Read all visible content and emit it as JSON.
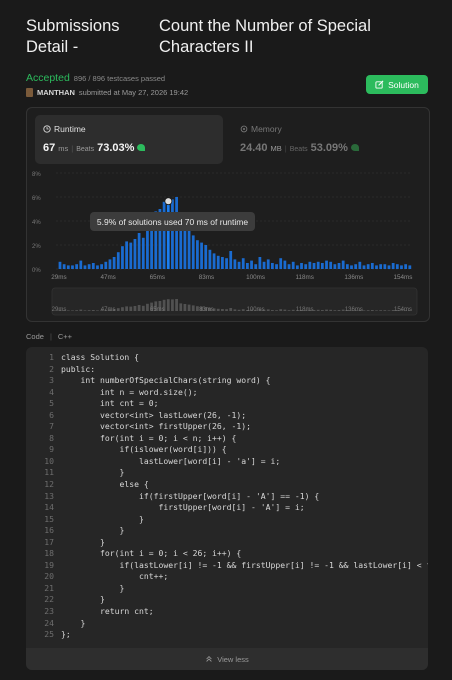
{
  "header": {
    "title_left": "Submissions Detail -",
    "title_right": "Count the Number of Special Characters II"
  },
  "status": {
    "result": "Accepted",
    "testcases": "896 / 896 testcases passed"
  },
  "submitter": {
    "name": "MANTHAN",
    "submitted": "submitted at May 27, 2026 19:42"
  },
  "solution_button": {
    "label": "Solution"
  },
  "runtime": {
    "label": "Runtime",
    "value": "67",
    "unit": "ms",
    "beats_label": "Beats",
    "beats_value": "73.03%"
  },
  "memory": {
    "label": "Memory",
    "value": "24.40",
    "unit": "MB",
    "beats_label": "Beats",
    "beats_value": "53.09%"
  },
  "tooltip": {
    "text": "5.9% of solutions used 70 ms of runtime"
  },
  "chart_data": {
    "type": "bar",
    "ylabel_ticks": [
      "8%",
      "6%",
      "4%",
      "2%",
      "0%"
    ],
    "ylim": [
      0,
      8
    ],
    "x_ticks": [
      "29ms",
      "47ms",
      "65ms",
      "83ms",
      "100ms",
      "118ms",
      "136ms",
      "154ms"
    ],
    "values": [
      0.6,
      0.4,
      0.3,
      0.3,
      0.4,
      0.7,
      0.3,
      0.4,
      0.5,
      0.3,
      0.4,
      0.6,
      0.8,
      1.0,
      1.4,
      1.9,
      2.3,
      2.2,
      2.5,
      3.0,
      2.6,
      3.6,
      4.2,
      4.8,
      5.0,
      5.6,
      5.9,
      5.8,
      6.0,
      3.8,
      3.5,
      3.2,
      2.8,
      2.4,
      2.2,
      2.0,
      1.6,
      1.3,
      1.1,
      1.0,
      0.9,
      1.5,
      0.8,
      0.6,
      0.9,
      0.5,
      0.7,
      0.4,
      1.0,
      0.6,
      0.8,
      0.5,
      0.4,
      0.9,
      0.7,
      0.4,
      0.6,
      0.3,
      0.5,
      0.4,
      0.6,
      0.5,
      0.6,
      0.5,
      0.7,
      0.6,
      0.4,
      0.5,
      0.7,
      0.4,
      0.3,
      0.4,
      0.6,
      0.3,
      0.4,
      0.5,
      0.3,
      0.4,
      0.4,
      0.3,
      0.5,
      0.4,
      0.3,
      0.4,
      0.3
    ],
    "highlighted_index": 26,
    "highlight_color": "#1a7ef2",
    "bar_color": "#1a6bd0",
    "dim_bar_color": "#4a4a4a"
  },
  "code_tab": {
    "label": "Code",
    "lang": "C++"
  },
  "code_lines": [
    "class Solution {",
    "public:",
    "    int numberOfSpecialChars(string word) {",
    "        int n = word.size();",
    "        int cnt = 0;",
    "        vector<int> lastLower(26, -1);",
    "        vector<int> firstUpper(26, -1);",
    "        for(int i = 0; i < n; i++) {",
    "            if(islower(word[i])) {",
    "                lastLower[word[i] - 'a'] = i;",
    "            }",
    "            else {",
    "                if(firstUpper[word[i] - 'A'] == -1) {",
    "                    firstUpper[word[i] - 'A'] = i;",
    "                }",
    "            }",
    "        }",
    "        for(int i = 0; i < 26; i++) {",
    "            if(lastLower[i] != -1 && firstUpper[i] != -1 && lastLower[i] < f",
    "                cnt++;",
    "            }",
    "        }",
    "        return cnt;",
    "    }",
    "};"
  ],
  "view_less": {
    "label": "View less"
  },
  "colors": {
    "accent": "#2cbb5d",
    "background": "#1a1a1a"
  }
}
